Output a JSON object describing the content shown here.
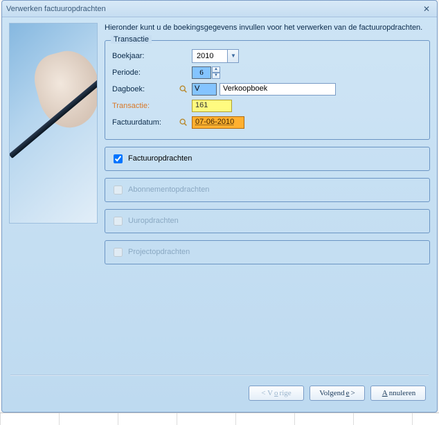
{
  "window": {
    "title": "Verwerken factuuropdrachten"
  },
  "instruction": "Hieronder kunt u de boekingsgegevens invullen voor het verwerken van de factuuropdrachten.",
  "transactie": {
    "legend": "Transactie",
    "boekjaar_label": "Boekjaar:",
    "boekjaar_value": "2010",
    "periode_label": "Periode:",
    "periode_value": "6",
    "dagboek_label": "Dagboek:",
    "dagboek_code": "V",
    "dagboek_name": "Verkoopboek",
    "transactie_label": "Transactie:",
    "transactie_value": "161",
    "factuurdatum_label": "Factuurdatum:",
    "factuurdatum_value": "07-06-2010"
  },
  "options": {
    "factuuropdrachten": "Factuuropdrachten",
    "abonnementopdrachten": "Abonnementopdrachten",
    "uuropdrachten": "Uuropdrachten",
    "projectopdrachten": "Projectopdrachten"
  },
  "buttons": {
    "vorige_pre": "< V",
    "vorige_u": "o",
    "vorige_post": "rige",
    "volgende_pre": "Volgend",
    "volgende_u": "e",
    "volgende_post": " >",
    "annuleren_pre": "",
    "annuleren_u": "A",
    "annuleren_post": "nnuleren"
  }
}
